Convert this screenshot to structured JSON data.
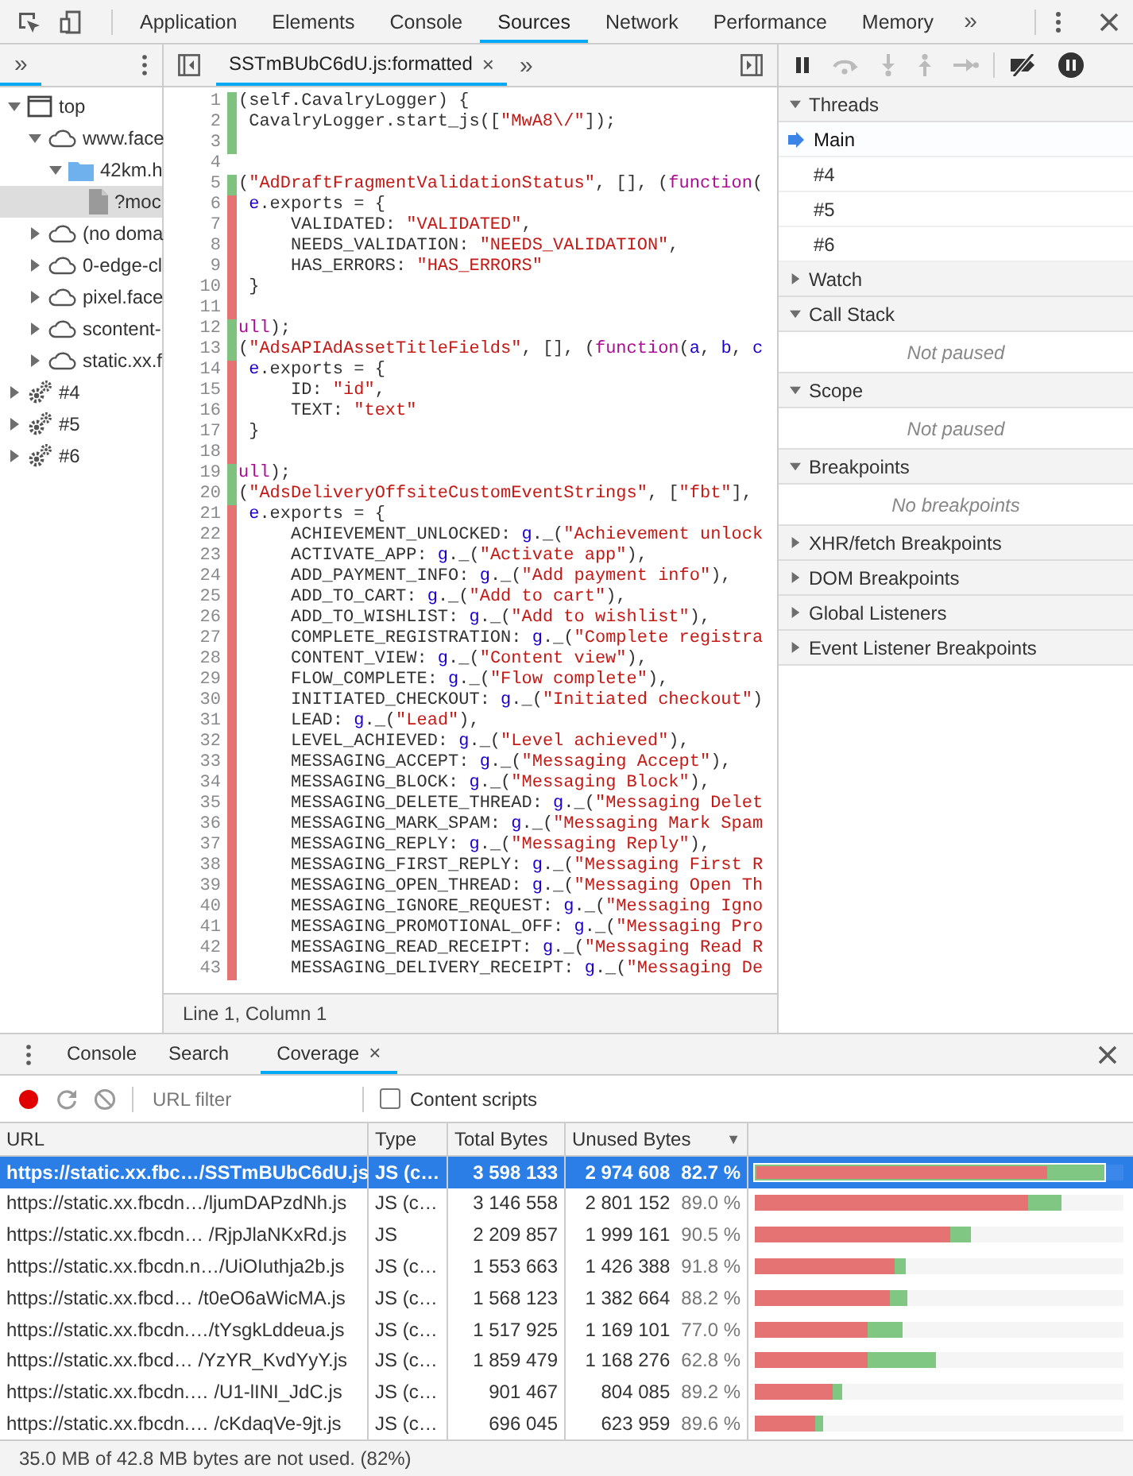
{
  "top_toolbar": {
    "tabs": [
      {
        "label": "Application",
        "selected": false
      },
      {
        "label": "Elements",
        "selected": false
      },
      {
        "label": "Console",
        "selected": false
      },
      {
        "label": "Sources",
        "selected": true
      },
      {
        "label": "Network",
        "selected": false
      },
      {
        "label": "Performance",
        "selected": false
      },
      {
        "label": "Memory",
        "selected": false
      }
    ],
    "overflow": "»"
  },
  "navigator": {
    "tabs": [
      {
        "label": "»",
        "selected": true
      }
    ],
    "tree": [
      {
        "label": "top",
        "kind": "frame",
        "expanded": true,
        "selected": false,
        "children": [
          {
            "label": "www.face",
            "kind": "domain",
            "expanded": true,
            "selected": false,
            "children": [
              {
                "label": "42km.h",
                "kind": "folder",
                "expanded": true,
                "selected": false,
                "children": [
                  {
                    "label": "?moc",
                    "kind": "file",
                    "selected": true
                  }
                ]
              }
            ]
          },
          {
            "label": "(no doma",
            "kind": "domain",
            "expanded": false,
            "selected": false
          },
          {
            "label": "0-edge-cl",
            "kind": "domain",
            "expanded": false,
            "selected": false
          },
          {
            "label": "pixel.face",
            "kind": "domain",
            "expanded": false,
            "selected": false
          },
          {
            "label": "scontent-",
            "kind": "domain",
            "expanded": false,
            "selected": false
          },
          {
            "label": "static.xx.f",
            "kind": "domain",
            "expanded": false,
            "selected": false
          }
        ]
      },
      {
        "label": "#4",
        "kind": "worker",
        "expanded": false,
        "selected": false
      },
      {
        "label": "#5",
        "kind": "worker",
        "expanded": false,
        "selected": false
      },
      {
        "label": "#6",
        "kind": "worker",
        "expanded": false,
        "selected": false
      }
    ]
  },
  "editor": {
    "tabs": [
      {
        "label": "SSTmBUbC6dU.js:formatted",
        "close": "×",
        "selected": true
      }
    ],
    "overflow": "»",
    "lines": [
      {
        "number": "1",
        "kind": "used",
        "parts": [
          {
            "kind": "plain",
            "text": "(self.CavalryLogger) {"
          }
        ]
      },
      {
        "number": "2",
        "kind": "used",
        "parts": [
          {
            "kind": "plain",
            "text": " CavalryLogger.start_js(["
          },
          {
            "kind": "string",
            "text": "\"MwA8\\/\""
          },
          {
            "kind": "plain",
            "text": "]);"
          }
        ]
      },
      {
        "number": "3",
        "kind": "used"
      },
      {
        "number": "4",
        "kind": "none"
      },
      {
        "number": "5",
        "kind": "used",
        "parts": [
          {
            "kind": "plain",
            "text": "("
          },
          {
            "kind": "string",
            "text": "\"AdDraftFragmentValidationStatus\""
          },
          {
            "kind": "plain",
            "text": ", [], ("
          },
          {
            "kind": "keyword",
            "text": "function"
          },
          {
            "kind": "plain",
            "text": "("
          }
        ]
      },
      {
        "number": "6",
        "kind": "unused",
        "parts": [
          {
            "kind": "variable",
            "text": " e"
          },
          {
            "kind": "plain",
            "text": ".exports = {"
          }
        ]
      },
      {
        "number": "7",
        "kind": "unused",
        "parts": [
          {
            "kind": "plain",
            "text": "     VALIDATED: "
          },
          {
            "kind": "string",
            "text": "\"VALIDATED\""
          },
          {
            "kind": "plain",
            "text": ","
          }
        ]
      },
      {
        "number": "8",
        "kind": "unused",
        "parts": [
          {
            "kind": "plain",
            "text": "     NEEDS_VALIDATION: "
          },
          {
            "kind": "string",
            "text": "\"NEEDS_VALIDATION\""
          },
          {
            "kind": "plain",
            "text": ","
          }
        ]
      },
      {
        "number": "9",
        "kind": "unused",
        "parts": [
          {
            "kind": "plain",
            "text": "     HAS_ERRORS: "
          },
          {
            "kind": "string",
            "text": "\"HAS_ERRORS\""
          }
        ]
      },
      {
        "number": "10",
        "kind": "unused",
        "parts": [
          {
            "kind": "plain",
            "text": " }"
          }
        ]
      },
      {
        "number": "11",
        "kind": "unused"
      },
      {
        "number": "12",
        "kind": "used",
        "parts": [
          {
            "kind": "keyword",
            "text": "ull"
          },
          {
            "kind": "plain",
            "text": ");"
          }
        ]
      },
      {
        "number": "13",
        "kind": "used",
        "parts": [
          {
            "kind": "plain",
            "text": "("
          },
          {
            "kind": "string",
            "text": "\"AdsAPIAdAssetTitleFields\""
          },
          {
            "kind": "plain",
            "text": ", [], ("
          },
          {
            "kind": "keyword",
            "text": "function"
          },
          {
            "kind": "plain",
            "text": "("
          },
          {
            "kind": "variable",
            "text": "a"
          },
          {
            "kind": "plain",
            "text": ", "
          },
          {
            "kind": "variable",
            "text": "b"
          },
          {
            "kind": "plain",
            "text": ", "
          },
          {
            "kind": "variable",
            "text": "c"
          }
        ]
      },
      {
        "number": "14",
        "kind": "unused",
        "parts": [
          {
            "kind": "variable",
            "text": " e"
          },
          {
            "kind": "plain",
            "text": ".exports = {"
          }
        ]
      },
      {
        "number": "15",
        "kind": "unused",
        "parts": [
          {
            "kind": "plain",
            "text": "     ID: "
          },
          {
            "kind": "string",
            "text": "\"id\""
          },
          {
            "kind": "plain",
            "text": ","
          }
        ]
      },
      {
        "number": "16",
        "kind": "unused",
        "parts": [
          {
            "kind": "plain",
            "text": "     TEXT: "
          },
          {
            "kind": "string",
            "text": "\"text\""
          }
        ]
      },
      {
        "number": "17",
        "kind": "unused",
        "parts": [
          {
            "kind": "plain",
            "text": " }"
          }
        ]
      },
      {
        "number": "18",
        "kind": "unused"
      },
      {
        "number": "19",
        "kind": "used",
        "parts": [
          {
            "kind": "keyword",
            "text": "ull"
          },
          {
            "kind": "plain",
            "text": ");"
          }
        ]
      },
      {
        "number": "20",
        "kind": "used",
        "parts": [
          {
            "kind": "plain",
            "text": "("
          },
          {
            "kind": "string",
            "text": "\"AdsDeliveryOffsiteCustomEventStrings\""
          },
          {
            "kind": "plain",
            "text": ", ["
          },
          {
            "kind": "string",
            "text": "\"fbt\""
          },
          {
            "kind": "plain",
            "text": "],"
          }
        ]
      },
      {
        "number": "21",
        "kind": "unused",
        "parts": [
          {
            "kind": "variable",
            "text": " e"
          },
          {
            "kind": "plain",
            "text": ".exports = {"
          }
        ]
      },
      {
        "number": "22",
        "kind": "unused",
        "parts": [
          {
            "kind": "plain",
            "text": "     ACHIEVEMENT_UNLOCKED: "
          },
          {
            "kind": "variable",
            "text": "g"
          },
          {
            "kind": "plain",
            "text": "._("
          },
          {
            "kind": "string",
            "text": "\"Achievement unlock"
          }
        ]
      },
      {
        "number": "23",
        "kind": "unused",
        "parts": [
          {
            "kind": "plain",
            "text": "     ACTIVATE_APP: "
          },
          {
            "kind": "variable",
            "text": "g"
          },
          {
            "kind": "plain",
            "text": "._("
          },
          {
            "kind": "string",
            "text": "\"Activate app\""
          },
          {
            "kind": "plain",
            "text": "),"
          }
        ]
      },
      {
        "number": "24",
        "kind": "unused",
        "parts": [
          {
            "kind": "plain",
            "text": "     ADD_PAYMENT_INFO: "
          },
          {
            "kind": "variable",
            "text": "g"
          },
          {
            "kind": "plain",
            "text": "._("
          },
          {
            "kind": "string",
            "text": "\"Add payment info\""
          },
          {
            "kind": "plain",
            "text": "),"
          }
        ]
      },
      {
        "number": "25",
        "kind": "unused",
        "parts": [
          {
            "kind": "plain",
            "text": "     ADD_TO_CART: "
          },
          {
            "kind": "variable",
            "text": "g"
          },
          {
            "kind": "plain",
            "text": "._("
          },
          {
            "kind": "string",
            "text": "\"Add to cart\""
          },
          {
            "kind": "plain",
            "text": "),"
          }
        ]
      },
      {
        "number": "26",
        "kind": "unused",
        "parts": [
          {
            "kind": "plain",
            "text": "     ADD_TO_WISHLIST: "
          },
          {
            "kind": "variable",
            "text": "g"
          },
          {
            "kind": "plain",
            "text": "._("
          },
          {
            "kind": "string",
            "text": "\"Add to wishlist\""
          },
          {
            "kind": "plain",
            "text": "),"
          }
        ]
      },
      {
        "number": "27",
        "kind": "unused",
        "parts": [
          {
            "kind": "plain",
            "text": "     COMPLETE_REGISTRATION: "
          },
          {
            "kind": "variable",
            "text": "g"
          },
          {
            "kind": "plain",
            "text": "._("
          },
          {
            "kind": "string",
            "text": "\"Complete registra"
          }
        ]
      },
      {
        "number": "28",
        "kind": "unused",
        "parts": [
          {
            "kind": "plain",
            "text": "     CONTENT_VIEW: "
          },
          {
            "kind": "variable",
            "text": "g"
          },
          {
            "kind": "plain",
            "text": "._("
          },
          {
            "kind": "string",
            "text": "\"Content view\""
          },
          {
            "kind": "plain",
            "text": "),"
          }
        ]
      },
      {
        "number": "29",
        "kind": "unused",
        "parts": [
          {
            "kind": "plain",
            "text": "     FLOW_COMPLETE: "
          },
          {
            "kind": "variable",
            "text": "g"
          },
          {
            "kind": "plain",
            "text": "._("
          },
          {
            "kind": "string",
            "text": "\"Flow complete\""
          },
          {
            "kind": "plain",
            "text": "),"
          }
        ]
      },
      {
        "number": "30",
        "kind": "unused",
        "parts": [
          {
            "kind": "plain",
            "text": "     INITIATED_CHECKOUT: "
          },
          {
            "kind": "variable",
            "text": "g"
          },
          {
            "kind": "plain",
            "text": "._("
          },
          {
            "kind": "string",
            "text": "\"Initiated checkout\""
          },
          {
            "kind": "plain",
            "text": ")"
          }
        ]
      },
      {
        "number": "31",
        "kind": "unused",
        "parts": [
          {
            "kind": "plain",
            "text": "     LEAD: "
          },
          {
            "kind": "variable",
            "text": "g"
          },
          {
            "kind": "plain",
            "text": "._("
          },
          {
            "kind": "string",
            "text": "\"Lead\""
          },
          {
            "kind": "plain",
            "text": "),"
          }
        ]
      },
      {
        "number": "32",
        "kind": "unused",
        "parts": [
          {
            "kind": "plain",
            "text": "     LEVEL_ACHIEVED: "
          },
          {
            "kind": "variable",
            "text": "g"
          },
          {
            "kind": "plain",
            "text": "._("
          },
          {
            "kind": "string",
            "text": "\"Level achieved\""
          },
          {
            "kind": "plain",
            "text": "),"
          }
        ]
      },
      {
        "number": "33",
        "kind": "unused",
        "parts": [
          {
            "kind": "plain",
            "text": "     MESSAGING_ACCEPT: "
          },
          {
            "kind": "variable",
            "text": "g"
          },
          {
            "kind": "plain",
            "text": "._("
          },
          {
            "kind": "string",
            "text": "\"Messaging Accept\""
          },
          {
            "kind": "plain",
            "text": "),"
          }
        ]
      },
      {
        "number": "34",
        "kind": "unused",
        "parts": [
          {
            "kind": "plain",
            "text": "     MESSAGING_BLOCK: "
          },
          {
            "kind": "variable",
            "text": "g"
          },
          {
            "kind": "plain",
            "text": "._("
          },
          {
            "kind": "string",
            "text": "\"Messaging Block\""
          },
          {
            "kind": "plain",
            "text": "),"
          }
        ]
      },
      {
        "number": "35",
        "kind": "unused",
        "parts": [
          {
            "kind": "plain",
            "text": "     MESSAGING_DELETE_THREAD: "
          },
          {
            "kind": "variable",
            "text": "g"
          },
          {
            "kind": "plain",
            "text": "._("
          },
          {
            "kind": "string",
            "text": "\"Messaging Delet"
          }
        ]
      },
      {
        "number": "36",
        "kind": "unused",
        "parts": [
          {
            "kind": "plain",
            "text": "     MESSAGING_MARK_SPAM: "
          },
          {
            "kind": "variable",
            "text": "g"
          },
          {
            "kind": "plain",
            "text": "._("
          },
          {
            "kind": "string",
            "text": "\"Messaging Mark Spam"
          }
        ]
      },
      {
        "number": "37",
        "kind": "unused",
        "parts": [
          {
            "kind": "plain",
            "text": "     MESSAGING_REPLY: "
          },
          {
            "kind": "variable",
            "text": "g"
          },
          {
            "kind": "plain",
            "text": "._("
          },
          {
            "kind": "string",
            "text": "\"Messaging Reply\""
          },
          {
            "kind": "plain",
            "text": "),"
          }
        ]
      },
      {
        "number": "38",
        "kind": "unused",
        "parts": [
          {
            "kind": "plain",
            "text": "     MESSAGING_FIRST_REPLY: "
          },
          {
            "kind": "variable",
            "text": "g"
          },
          {
            "kind": "plain",
            "text": "._("
          },
          {
            "kind": "string",
            "text": "\"Messaging First R"
          }
        ]
      },
      {
        "number": "39",
        "kind": "unused",
        "parts": [
          {
            "kind": "plain",
            "text": "     MESSAGING_OPEN_THREAD: "
          },
          {
            "kind": "variable",
            "text": "g"
          },
          {
            "kind": "plain",
            "text": "._("
          },
          {
            "kind": "string",
            "text": "\"Messaging Open Th"
          }
        ]
      },
      {
        "number": "40",
        "kind": "unused",
        "parts": [
          {
            "kind": "plain",
            "text": "     MESSAGING_IGNORE_REQUEST: "
          },
          {
            "kind": "variable",
            "text": "g"
          },
          {
            "kind": "plain",
            "text": "._("
          },
          {
            "kind": "string",
            "text": "\"Messaging Igno"
          }
        ]
      },
      {
        "number": "41",
        "kind": "unused",
        "parts": [
          {
            "kind": "plain",
            "text": "     MESSAGING_PROMOTIONAL_OFF: "
          },
          {
            "kind": "variable",
            "text": "g"
          },
          {
            "kind": "plain",
            "text": "._("
          },
          {
            "kind": "string",
            "text": "\"Messaging Pro"
          }
        ]
      },
      {
        "number": "42",
        "kind": "unused",
        "parts": [
          {
            "kind": "plain",
            "text": "     MESSAGING_READ_RECEIPT: "
          },
          {
            "kind": "variable",
            "text": "g"
          },
          {
            "kind": "plain",
            "text": "._("
          },
          {
            "kind": "string",
            "text": "\"Messaging Read R"
          }
        ]
      },
      {
        "number": "43",
        "kind": "unused",
        "parts": [
          {
            "kind": "plain",
            "text": "     MESSAGING_DELIVERY_RECEIPT: "
          },
          {
            "kind": "variable",
            "text": "g"
          },
          {
            "kind": "plain",
            "text": "._("
          },
          {
            "kind": "string",
            "text": "\"Messaging De"
          }
        ]
      }
    ],
    "status": "Line 1, Column 1"
  },
  "debugger": {
    "toolbar": [
      {
        "kind": "pause",
        "disabled": false
      },
      {
        "kind": "step-over",
        "disabled": true
      },
      {
        "kind": "step-into",
        "disabled": true
      },
      {
        "kind": "step-out",
        "disabled": true
      },
      {
        "kind": "step",
        "disabled": true
      },
      {
        "kind": "deactivate",
        "disabled": false
      },
      {
        "kind": "pause-exceptions",
        "disabled": false
      }
    ],
    "sections": [
      {
        "title": "Threads",
        "expanded": true,
        "threads": [
          {
            "label": "Main",
            "selected": true
          },
          {
            "label": "#4",
            "selected": false
          },
          {
            "label": "#5",
            "selected": false
          },
          {
            "label": "#6",
            "selected": false
          }
        ]
      },
      {
        "title": "Watch",
        "expanded": false
      },
      {
        "title": "Call Stack",
        "expanded": true,
        "message": "Not paused"
      },
      {
        "title": "Scope",
        "expanded": true,
        "message": "Not paused"
      },
      {
        "title": "Breakpoints",
        "expanded": true,
        "message": "No breakpoints"
      },
      {
        "title": "XHR/fetch Breakpoints",
        "expanded": false
      },
      {
        "title": "DOM Breakpoints",
        "expanded": false
      },
      {
        "title": "Global Listeners",
        "expanded": false
      },
      {
        "title": "Event Listener Breakpoints",
        "expanded": false
      }
    ]
  },
  "drawer": {
    "tabs": [
      {
        "label": "Console",
        "selected": false
      },
      {
        "label": "Search",
        "selected": false
      },
      {
        "label": "Coverage",
        "close": "×",
        "selected": true
      }
    ],
    "toolbar": {
      "recording": true,
      "filter": {
        "placeholder": "URL filter"
      },
      "content_scripts": {
        "label": "Content scripts",
        "checked": false
      }
    },
    "table": {
      "columns": [
        {
          "label": "URL"
        },
        {
          "label": "Type"
        },
        {
          "label": "Total Bytes"
        },
        {
          "label": "Unused Bytes",
          "sort": "▼"
        }
      ],
      "rows": [
        {
          "url": "https://static.xx.fbc…/SSTmBUbC6dU.js",
          "type": "JS (c…",
          "total_bytes": "3 598 133",
          "unused_bytes": "2 974 608",
          "unused_percent": "82.7 %",
          "unused_bar": {
            "level": 0.79
          },
          "total_bar": {
            "level": 0.95
          },
          "selected": true
        },
        {
          "url": "https://static.xx.fbcdn…/ljumDAPzdNh.js",
          "type": "JS (c…",
          "total_bytes": "3 146 558",
          "unused_bytes": "2 801 152",
          "unused_percent": "89.0 %",
          "unused_bar": {
            "level": 0.74
          },
          "total_bar": {
            "level": 0.83
          },
          "selected": false
        },
        {
          "url": "https://static.xx.fbcdn… /RjpJlaNKxRd.js",
          "type": "JS",
          "total_bytes": "2 209 857",
          "unused_bytes": "1 999 161",
          "unused_percent": "90.5 %",
          "unused_bar": {
            "level": 0.53
          },
          "total_bar": {
            "level": 0.586
          },
          "selected": false
        },
        {
          "url": "https://static.xx.fbcdn.n…/UiOIuthja2b.js",
          "type": "JS (c…",
          "total_bytes": "1 553 663",
          "unused_bytes": "1 426 388",
          "unused_percent": "91.8 %",
          "unused_bar": {
            "level": 0.38
          },
          "total_bar": {
            "level": 0.41
          },
          "selected": false
        },
        {
          "url": "https://static.xx.fbcd… /t0eO6aWicMA.js",
          "type": "JS (c…",
          "total_bytes": "1 568 123",
          "unused_bytes": "1 382 664",
          "unused_percent": "88.2 %",
          "unused_bar": {
            "level": 0.366
          },
          "total_bar": {
            "level": 0.413
          },
          "selected": false
        },
        {
          "url": "https://static.xx.fbcdn.…/tYsgkLddeua.js",
          "type": "JS (c…",
          "total_bytes": "1 517 925",
          "unused_bytes": "1 169 101",
          "unused_percent": "77.0 %",
          "unused_bar": {
            "level": 0.306
          },
          "total_bar": {
            "level": 0.401
          },
          "selected": false
        },
        {
          "url": "https://static.xx.fbcd… /YzYR_KvdYyY.js",
          "type": "JS (c…",
          "total_bytes": "1 859 479",
          "unused_bytes": "1 168 276",
          "unused_percent": "62.8 %",
          "unused_bar": {
            "level": 0.306
          },
          "total_bar": {
            "level": 0.491
          },
          "selected": false
        },
        {
          "url": "https://static.xx.fbcdn.… /U1-lINI_JdC.js",
          "type": "JS (c…",
          "total_bytes": "901 467",
          "unused_bytes": "804 085",
          "unused_percent": "89.2 %",
          "unused_bar": {
            "level": 0.21
          },
          "total_bar": {
            "level": 0.236
          },
          "selected": false
        },
        {
          "url": "https://static.xx.fbcdn.… /cKdaqVe-9jt.js",
          "type": "JS (c…",
          "total_bytes": "696 045",
          "unused_bytes": "623 959",
          "unused_percent": "89.6 %",
          "unused_bar": {
            "level": 0.165
          },
          "total_bar": {
            "level": 0.185
          },
          "selected": false
        }
      ]
    },
    "status": "35.0 MB of 42.8 MB bytes are not used. (82%)"
  }
}
